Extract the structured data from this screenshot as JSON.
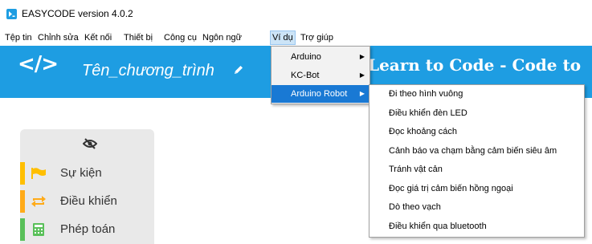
{
  "window": {
    "title": "EASYCODE version 4.0.2",
    "icon": "easycode-logo-icon"
  },
  "menubar": {
    "items": [
      {
        "label": "Tệp tin"
      },
      {
        "label": "Chỉnh sửa"
      },
      {
        "label": "Kết nối"
      },
      {
        "label": "Thiết bị"
      },
      {
        "label": "Công cụ"
      },
      {
        "label": "Ngôn ngữ"
      },
      {
        "label": "Ví dụ",
        "active": true
      },
      {
        "label": "Trợ giúp"
      }
    ]
  },
  "header": {
    "code_symbol": "</>",
    "program_name": "Tên_chương_trình",
    "slogan": "Learn to Code - Code to",
    "background_color": "#1e9de2"
  },
  "examples_menu": {
    "items": [
      {
        "label": "Arduino",
        "arrow": "▶"
      },
      {
        "label": "KC-Bot",
        "arrow": "▶"
      },
      {
        "label": "Arduino Robot",
        "arrow": "▶",
        "highlighted": true
      }
    ],
    "highlight_color": "#1979d4"
  },
  "robot_submenu": {
    "items": [
      {
        "label": "Đi theo hình vuông"
      },
      {
        "label": "Điều khiển đèn LED"
      },
      {
        "label": "Đọc khoảng cách"
      },
      {
        "label": "Cảnh báo va chạm bằng cảm biến siêu âm"
      },
      {
        "label": "Tránh vật cản"
      },
      {
        "label": "Đọc giá trị cảm biến hồng ngoại"
      },
      {
        "label": "Dò theo vạch"
      },
      {
        "label": "Điều khiển qua bluetooth"
      }
    ]
  },
  "block_categories": {
    "toggle_icon": "eye-slash-icon",
    "items": [
      {
        "label": "Sự kiện",
        "color": "#ffbf00",
        "icon": "flag-icon"
      },
      {
        "label": "Điều khiển",
        "color": "#ffab19",
        "icon": "loop-icon"
      },
      {
        "label": "Phép toán",
        "color": "#59c059",
        "icon": "calculator-icon"
      }
    ]
  }
}
